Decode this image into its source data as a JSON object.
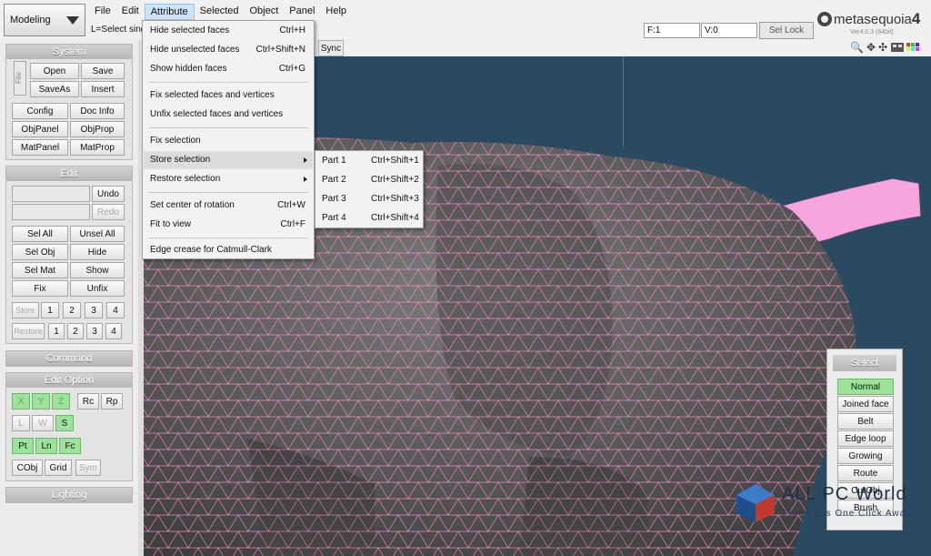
{
  "mode": {
    "label": "Modeling"
  },
  "menubar": [
    "File",
    "Edit",
    "Attribute",
    "Selected",
    "Object",
    "Panel",
    "Help"
  ],
  "status": {
    "hint": "L=Select singl",
    "faces": "F:1",
    "verts": "V:0",
    "sel_lock": "Sel Lock"
  },
  "logo": {
    "name": "metasequoia",
    "num": "4",
    "version": "Ver4.0.3 (64bit)"
  },
  "sync_label": "Sync",
  "system": {
    "title": "System",
    "file_tab": "File",
    "open": "Open",
    "save": "Save",
    "saveas": "SaveAs",
    "insert": "Insert",
    "config": "Config",
    "docinfo": "Doc Info",
    "objpanel": "ObjPanel",
    "objprop": "ObjProp",
    "matpanel": "MatPanel",
    "matprop": "MatProp"
  },
  "edit": {
    "title": "Edit",
    "undo": "Undo",
    "redo": "Redo",
    "selall": "Sel All",
    "unselall": "Unsel All",
    "selobj": "Sel Obj",
    "hide": "Hide",
    "selmat": "Sel Mat",
    "show": "Show",
    "fix": "Fix",
    "unfix": "Unfix",
    "store": "Store",
    "restore": "Restore",
    "slots": [
      "1",
      "2",
      "3",
      "4"
    ]
  },
  "command": {
    "title": "Command"
  },
  "edit_option": {
    "title": "Edit Option",
    "x": "X",
    "y": "Y",
    "z": "Z",
    "rc": "Rc",
    "rp": "Rp",
    "l": "L",
    "w": "W",
    "s": "S",
    "pt": "Pt",
    "ln": "Ln",
    "fc": "Fc",
    "cobj": "CObj",
    "grid": "Grid",
    "sym": "Sym"
  },
  "lighting": {
    "title": "Lighting"
  },
  "attribute_menu": [
    {
      "label": "Hide selected faces",
      "shortcut": "Ctrl+H"
    },
    {
      "label": "Hide unselected faces",
      "shortcut": "Ctrl+Shift+N"
    },
    {
      "label": "Show hidden faces",
      "shortcut": "Ctrl+G"
    },
    {
      "label": "Fix selected faces and vertices",
      "shortcut": ""
    },
    {
      "label": "Unfix selected faces and vertices",
      "shortcut": ""
    },
    {
      "label": "Fix selection",
      "shortcut": ""
    },
    {
      "label": "Store selection",
      "shortcut": ""
    },
    {
      "label": "Restore selection",
      "shortcut": ""
    },
    {
      "label": "Set center of rotation",
      "shortcut": "Ctrl+W"
    },
    {
      "label": "Fit to view",
      "shortcut": "Ctrl+F"
    },
    {
      "label": "Edge crease for Catmull-Clark",
      "shortcut": ""
    }
  ],
  "store_submenu": [
    {
      "label": "Part 1",
      "shortcut": "Ctrl+Shift+1"
    },
    {
      "label": "Part 2",
      "shortcut": "Ctrl+Shift+2"
    },
    {
      "label": "Part 3",
      "shortcut": "Ctrl+Shift+3"
    },
    {
      "label": "Part 4",
      "shortcut": "Ctrl+Shift+4"
    }
  ],
  "select_panel": {
    "title": "Select",
    "items": [
      "Normal",
      "Joined face",
      "Belt",
      "Edge loop",
      "Growing",
      "Route",
      "CurObj",
      "Brush"
    ]
  },
  "watermark": {
    "title": "ALL PC World",
    "subtitle": "Free Apps One Click Away"
  },
  "colors": {
    "viewport_bg": "#2a4a62",
    "mesh_fill": "#5a5a5a",
    "wire": "#ff8fd0",
    "active_green": "#9de29a"
  }
}
